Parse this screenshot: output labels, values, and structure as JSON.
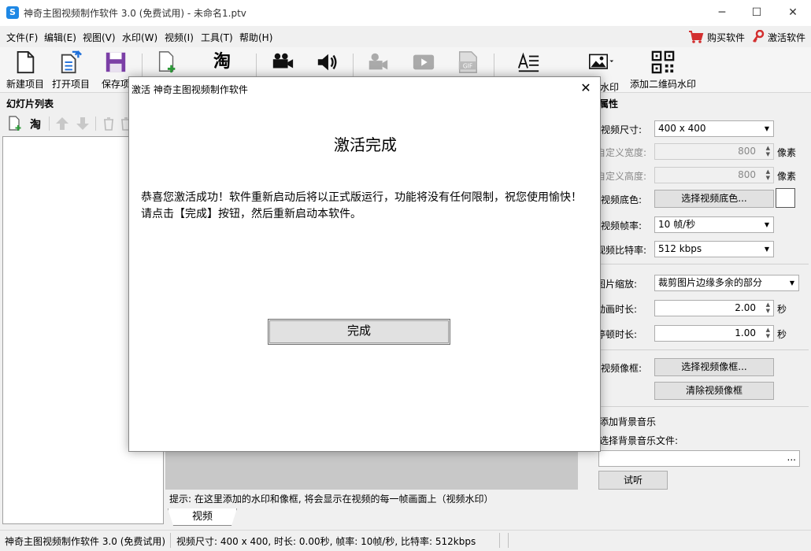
{
  "window": {
    "title": "神奇主图视频制作软件 3.0 (免费试用) - 未命名1.ptv",
    "app_icon_glyph": "S",
    "minimize": "─",
    "maximize": "☐",
    "close": "✕"
  },
  "menu": {
    "items": [
      "文件(F)",
      "编辑(E)",
      "视图(V)",
      "水印(W)",
      "视频(I)",
      "工具(T)",
      "帮助(H)"
    ],
    "buy": "购买软件",
    "activate": "激活软件"
  },
  "toolbar": {
    "new_project": "新建项目",
    "open_project": "打开项目",
    "save_project": "保存项",
    "tao_glyph": "淘",
    "watermark_label": "水印",
    "qr_watermark": "添加二维码水印"
  },
  "left_panel": {
    "title": "幻灯片列表",
    "tao_glyph": "淘"
  },
  "right_panel": {
    "title": "属性",
    "video_size_label": "视频尺寸:",
    "video_size_value": "400 x 400",
    "custom_width_label": "自定义宽度:",
    "custom_width_value": "800",
    "custom_height_label": "自定义高度:",
    "custom_height_value": "800",
    "px_unit": "像素",
    "bg_color_label": "视频底色:",
    "bg_color_button": "选择视频底色...",
    "bg_color_value": "#ffffff",
    "frame_rate_label": "视频帧率:",
    "frame_rate_value": "10 帧/秒",
    "bitrate_label": "视频比特率:",
    "bitrate_value": "512 kbps",
    "image_scale_label": "图片缩放:",
    "image_scale_value": "裁剪图片边缘多余的部分",
    "anim_duration_label": "动画时长:",
    "anim_duration_value": "2.00",
    "pause_duration_label": "停顿时长:",
    "pause_duration_value": "1.00",
    "seconds_unit": "秒",
    "frame_label": "视频像框:",
    "select_frame_button": "选择视频像框...",
    "clear_frame_button": "清除视频像框",
    "bg_music_label": "添加背景音乐",
    "bg_music_file_label": "选择背景音乐文件:",
    "file_browse": "...",
    "listen_button": "试听"
  },
  "preview": {
    "hint": "提示: 在这里添加的水印和像框, 将会显示在视频的每一帧画面上（视频水印）",
    "tab_video": "视频"
  },
  "status": {
    "app_name": "神奇主图视频制作软件 3.0 (免费试用)",
    "info": "视频尺寸: 400 x 400, 时长: 0.00秒, 帧率: 10帧/秒, 比特率: 512kbps"
  },
  "dialog": {
    "title": "激活 神奇主图视频制作软件",
    "close": "✕",
    "heading": "激活完成",
    "body": "恭喜您激活成功！软件重新启动后将以正式版运行，功能将没有任何限制，祝您使用愉快！请点击【完成】按钮，然后重新启动本软件。",
    "done_button": "完成"
  }
}
